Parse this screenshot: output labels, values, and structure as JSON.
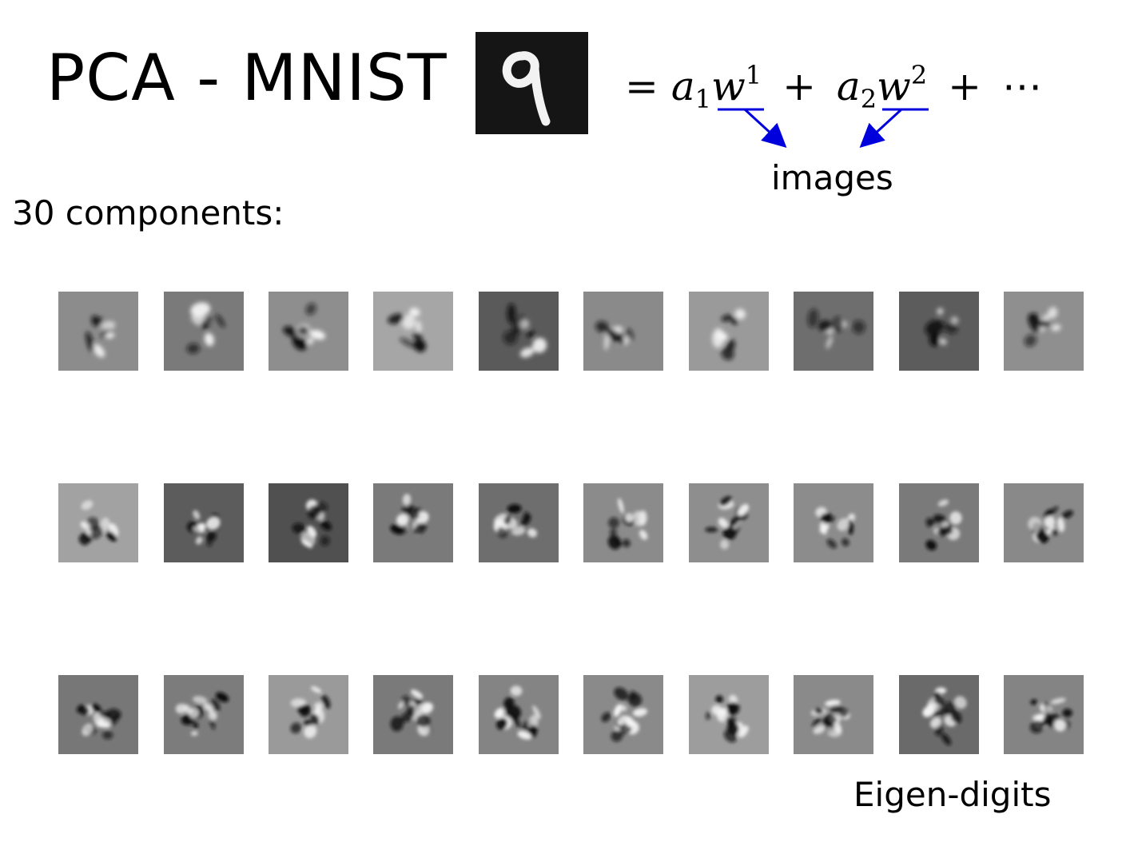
{
  "slide": {
    "title": "PCA - MNIST",
    "components_label": "30 components:",
    "images_label": "images",
    "eigen_label": "Eigen-digits"
  },
  "equation": {
    "equals": "=",
    "a": "a",
    "w": "w",
    "sub1": "1",
    "sup1": "1",
    "sub2": "2",
    "sup2": "2",
    "plus": "+",
    "ellipsis": "⋯"
  },
  "colors": {
    "arrow": "#0000dd",
    "digit_background": "#151515",
    "digit_stroke": "#f2f2f2"
  },
  "eigen_digits": {
    "rows": 3,
    "columns": 10,
    "tile_background_grays": [
      [
        "#8c8c8c",
        "#7a7a7a",
        "#8e8e8e",
        "#a6a6a6",
        "#5a5a5a",
        "#8a8a8a",
        "#9a9a9a",
        "#6e6e6e",
        "#5c5c5c",
        "#8f8f8f"
      ],
      [
        "#a2a2a2",
        "#5c5c5c",
        "#505050",
        "#7a7a7a",
        "#6e6e6e",
        "#8b8b8b",
        "#8e8e8e",
        "#8c8c8c",
        "#7a7a7a",
        "#898989"
      ],
      [
        "#777777",
        "#7c7c7c",
        "#9a9a9a",
        "#7a7a7a",
        "#848484",
        "#8a8a8a",
        "#9d9d9d",
        "#8a8a8a",
        "#6a6a6a",
        "#848484"
      ]
    ]
  }
}
